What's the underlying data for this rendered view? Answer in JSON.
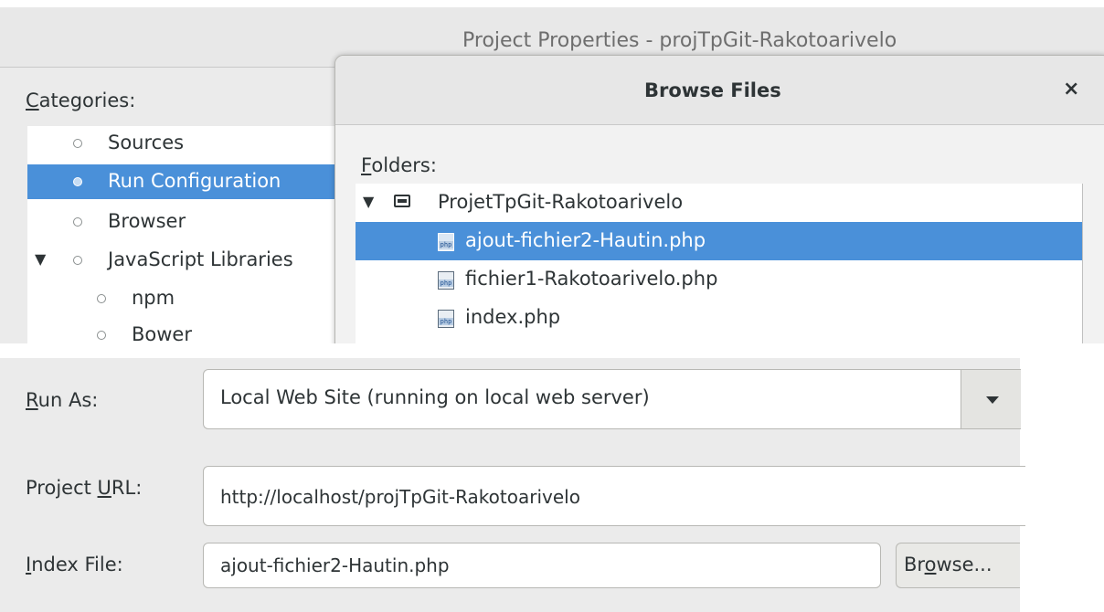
{
  "window": {
    "title": "Project Properties - projTpGit-Rakotoarivelo"
  },
  "categories": {
    "label_mnemonic": "C",
    "label_rest": "ategories:",
    "items": [
      {
        "label": "Sources",
        "selected": false,
        "level": 0
      },
      {
        "label": "Run Configuration",
        "selected": true,
        "level": 0
      },
      {
        "label": "Browser",
        "selected": false,
        "level": 0
      },
      {
        "label": "JavaScript Libraries",
        "selected": false,
        "level": 0,
        "expanded": true
      },
      {
        "label": "npm",
        "selected": false,
        "level": 1
      },
      {
        "label": "Bower",
        "selected": false,
        "level": 1
      }
    ]
  },
  "dialog": {
    "title": "Browse Files",
    "close_glyph": "×",
    "folders_label_mnemonic": "F",
    "folders_label_rest": "olders:",
    "root": {
      "label": "ProjetTpGit-Rakotoarivelo",
      "expanded": true,
      "icon": "folder-icon"
    },
    "files": [
      {
        "label": "ajout-fichier2-Hautin.php",
        "selected": true,
        "icon": "php-file-icon"
      },
      {
        "label": "fichier1-Rakotoarivelo.php",
        "selected": false,
        "icon": "php-file-icon"
      },
      {
        "label": "index.php",
        "selected": false,
        "icon": "php-file-icon"
      }
    ]
  },
  "form": {
    "run_as": {
      "label_mnemonic": "R",
      "label_rest": "un As:",
      "value": "Local Web Site (running on local web server)"
    },
    "project_url": {
      "label_pre": "Project ",
      "label_mnemonic": "U",
      "label_rest": "RL:",
      "value": "http://localhost/projTpGit-Rakotoarivelo"
    },
    "index_file": {
      "label_mnemonic": "I",
      "label_rest": "ndex File:",
      "value": "ajout-fichier2-Hautin.php"
    },
    "browse_button": {
      "pre": "Br",
      "mnemonic": "o",
      "rest": "wse..."
    }
  },
  "colors": {
    "selection": "#4a90d9",
    "window_bg": "#ebebeb",
    "text": "#2e3436"
  }
}
